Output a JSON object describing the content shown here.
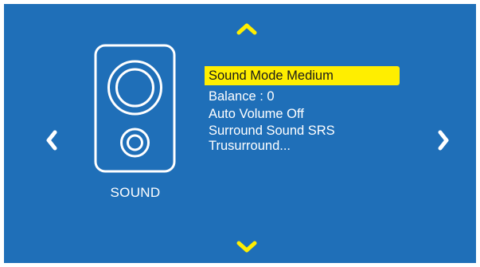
{
  "colors": {
    "background": "#1f6fb8",
    "accent_yellow": "#ffee00",
    "text": "#ffffff"
  },
  "nav": {
    "up_icon": "chevron-up-icon",
    "down_icon": "chevron-down-icon",
    "left_icon": "chevron-left-icon",
    "right_icon": "chevron-right-icon"
  },
  "category": {
    "icon": "speaker-icon",
    "label": "SOUND"
  },
  "menu": {
    "items": [
      {
        "label": "Sound Mode Medium",
        "selected": true
      },
      {
        "label": "Balance : 0",
        "selected": false
      },
      {
        "label": "Auto Volume Off",
        "selected": false
      },
      {
        "label": "Surround Sound SRS Trusurround...",
        "selected": false
      }
    ]
  }
}
